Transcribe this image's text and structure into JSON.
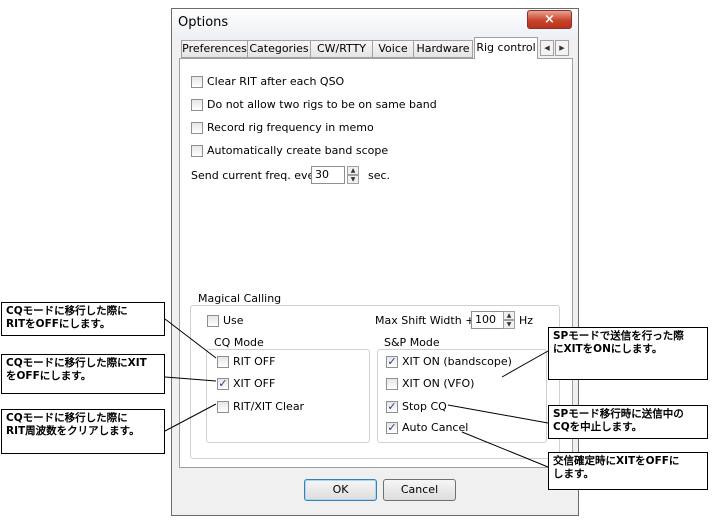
{
  "window": {
    "title": "Options",
    "close_icon": "×"
  },
  "tabs": [
    {
      "label": "Preferences"
    },
    {
      "label": "Categories"
    },
    {
      "label": "CW/RTTY"
    },
    {
      "label": "Voice"
    },
    {
      "label": "Hardware"
    },
    {
      "label": "Rig control"
    }
  ],
  "tab_scroll": {
    "left": "◀",
    "right": "▶"
  },
  "options": {
    "clear_rit": {
      "label": "Clear RIT after each QSO",
      "checked": false
    },
    "no_two_rigs": {
      "label": "Do not allow two rigs to be on same band",
      "checked": false
    },
    "record_freq": {
      "label": "Record rig frequency in memo",
      "checked": false
    },
    "auto_scope": {
      "label": "Automatically create band scope",
      "checked": false
    },
    "send_freq": {
      "prefix": "Send current freq. every",
      "value": "30",
      "suffix": "sec."
    }
  },
  "magical": {
    "title": "Magical Calling",
    "use": {
      "label": "Use",
      "checked": false
    },
    "max_shift": {
      "label": "Max Shift Width +/-",
      "value": "100",
      "unit": "Hz"
    },
    "cq_mode": {
      "title": "CQ Mode",
      "items": [
        {
          "label": "RIT OFF",
          "checked": false
        },
        {
          "label": "XIT OFF",
          "checked": true
        },
        {
          "label": "RIT/XIT Clear",
          "checked": false
        }
      ]
    },
    "sp_mode": {
      "title": "S&P Mode",
      "items": [
        {
          "label": "XIT ON (bandscope)",
          "checked": true
        },
        {
          "label": "XIT ON (VFO)",
          "checked": false
        },
        {
          "label": "Stop CQ",
          "checked": true
        },
        {
          "label": "Auto Cancel",
          "checked": true
        }
      ]
    }
  },
  "buttons": {
    "ok": "OK",
    "cancel": "Cancel"
  },
  "check_glyph": "✓",
  "spin": {
    "up": "▲",
    "down": "▼"
  },
  "callouts": {
    "rit_off": [
      "CQモードに移行した際に",
      "RITをOFFにします。"
    ],
    "xit_off": [
      "CQモードに移行した際にXIT",
      "をOFFにします。"
    ],
    "rit_clear": [
      "CQモードに移行した際に",
      "RIT周波数をクリアします。"
    ],
    "xit_on": [
      "SPモードで送信を行った際",
      "にXITをONにします。"
    ],
    "stop_cq": [
      "SPモード移行時に送信中の",
      "CQを中止します。"
    ],
    "auto_cancel": [
      "交信確定時にXITをOFFに",
      "します。"
    ]
  }
}
